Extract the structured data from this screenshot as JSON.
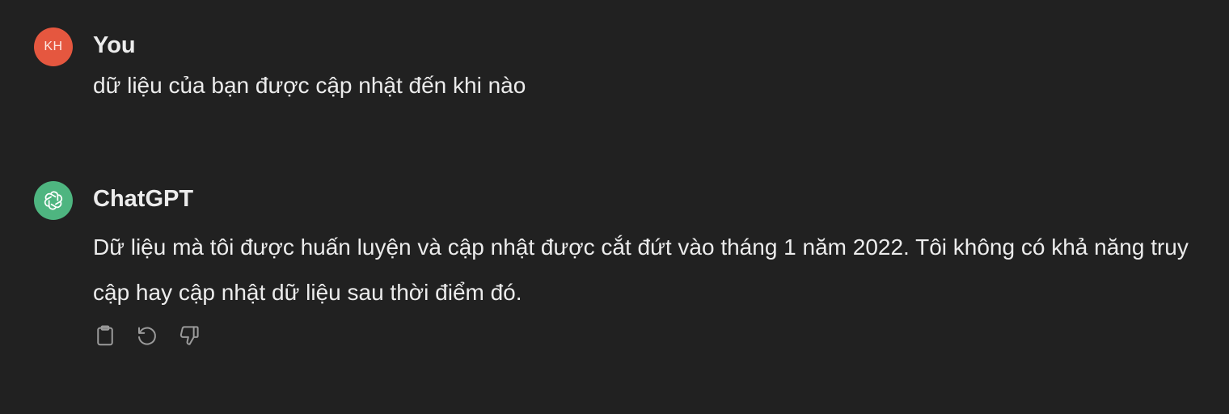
{
  "conversation": {
    "messages": [
      {
        "role": "user",
        "author": "You",
        "avatar_initials": "KH",
        "avatar_color": "#e5573f",
        "text": "dữ liệu của bạn được cập nhật đến khi nào"
      },
      {
        "role": "assistant",
        "author": "ChatGPT",
        "avatar_icon": "openai-logo-icon",
        "avatar_color": "#4eb580",
        "text": "Dữ liệu mà tôi được huấn luyện và cập nhật được cắt đứt vào tháng 1 năm 2022. Tôi không có khả năng truy cập hay cập nhật dữ liệu sau thời điểm đó.",
        "actions": [
          "copy-icon",
          "regenerate-icon",
          "thumbs-down-icon"
        ]
      }
    ]
  },
  "theme": {
    "background": "#212121",
    "text": "#ececec",
    "icon": "#9b9b9b"
  }
}
